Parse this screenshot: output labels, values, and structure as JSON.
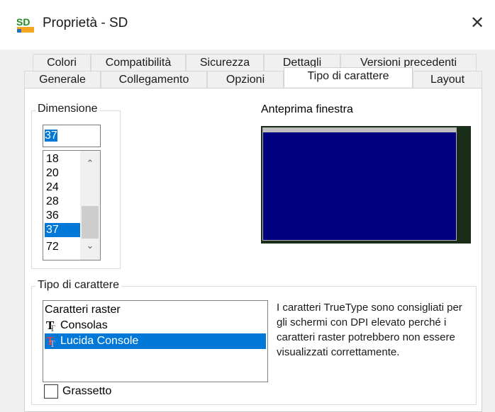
{
  "window": {
    "title": "Proprietà - SD",
    "icon_text": "SD",
    "close_glyph": "✕"
  },
  "tabs_row1": [
    "Colori",
    "Compatibilità",
    "Sicurezza",
    "Dettagli",
    "Versioni precedenti"
  ],
  "tabs_row2": [
    "Generale",
    "Collegamento",
    "Opzioni",
    "Tipo di carattere",
    "Layout"
  ],
  "active_tab": "Tipo di carattere",
  "size_group": {
    "label": "Dimensione",
    "input_value": "37",
    "items": [
      "18",
      "20",
      "24",
      "28",
      "36",
      "37",
      "72"
    ],
    "selected": "37",
    "scroll_up_glyph": "⌃",
    "scroll_down_glyph": "⌄"
  },
  "preview": {
    "label": "Anteprima finestra",
    "colors": {
      "screen": "#000080",
      "background": "#1a2e1a"
    }
  },
  "font_group": {
    "label": "Tipo di carattere",
    "items": [
      {
        "label": "Caratteri raster",
        "icon": "none"
      },
      {
        "label": "Consolas",
        "icon": "truetype-icon"
      },
      {
        "label": "Lucida Console",
        "icon": "truetype-icon"
      }
    ],
    "selected": "Lucida Console",
    "description": "I caratteri TrueType sono consigliati per gli schermi con DPI elevato perché i caratteri raster potrebbero non essere visualizzati correttamente."
  },
  "bold": {
    "label": "Grassetto",
    "checked": false
  },
  "accent": "#0078d7"
}
